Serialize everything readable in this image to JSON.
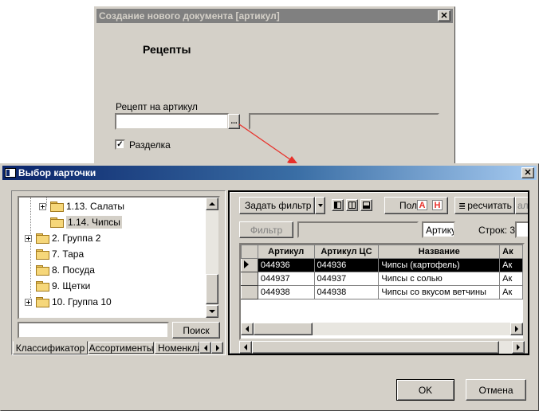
{
  "bg_dialog": {
    "title": "Создание нового документа [артикул]",
    "heading": "Рецепты",
    "recipe_label": "Рецепт на артикул",
    "browse_label": "...",
    "checkbox_label": "Разделка",
    "checkbox_checked": true
  },
  "dialog": {
    "title": "Выбор карточки",
    "ok_label": "OK",
    "cancel_label": "Отмена"
  },
  "tree": {
    "items": [
      {
        "label": "1.13. Салаты",
        "expandable": true,
        "open": false
      },
      {
        "label": "1.14. Чипсы",
        "expandable": false,
        "open": true,
        "selected": true
      },
      {
        "label": "2. Группа 2",
        "expandable": true
      },
      {
        "label": "7. Тара",
        "expandable": false
      },
      {
        "label": "8. Посуда",
        "expandable": false
      },
      {
        "label": "9. Щетки",
        "expandable": false
      },
      {
        "label": "10. Группа 10",
        "expandable": true
      }
    ],
    "search_value": "",
    "search_button": "Поиск",
    "tabs": [
      "Классификатор",
      "Ассортименты",
      "Номенкла"
    ]
  },
  "grid_panel": {
    "filter_dropdown": "Задать фильтр",
    "pol_label": "Пол",
    "red_a": "А",
    "red_h": "Н",
    "recount_label": "ресчитать",
    "al_label": "ал",
    "filter_button": "Фильтр",
    "filter_value": "",
    "field_combo": "Артику",
    "rows_label": "Строк: 3",
    "columns": [
      "Артикул",
      "Артикул ЦС",
      "Название",
      "Ак"
    ],
    "rows": [
      [
        "044936",
        "044936",
        "Чипсы (картофель)",
        "Ак"
      ],
      [
        "044937",
        "044937",
        "Чипсы с солью",
        "Ак"
      ],
      [
        "044938",
        "044938",
        "Чипсы со вкусом ветчины",
        "Ак"
      ]
    ],
    "selected_row": 0
  },
  "colors": {
    "title_active_start": "#0a246a",
    "title_active_end": "#a6caf0",
    "title_inactive": "#808080",
    "face": "#d4d0c8",
    "arrow": "#e8302a"
  }
}
